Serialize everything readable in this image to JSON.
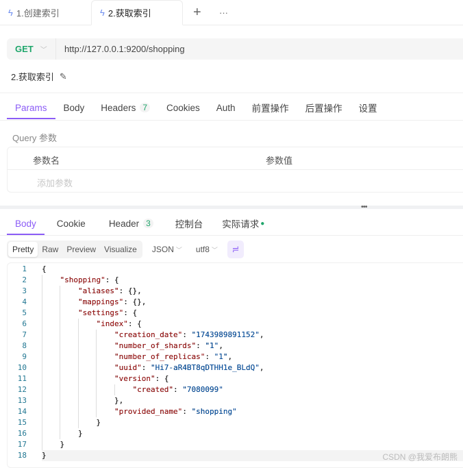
{
  "request_tabs": [
    {
      "label": "1.创建索引",
      "icon": "bolt-icon"
    },
    {
      "label": "2.获取索引",
      "icon": "bolt-icon",
      "active": true
    }
  ],
  "request": {
    "method": "GET",
    "url": "http://127.0.0.1:9200/shopping",
    "name": "2.获取索引"
  },
  "req_tabs": {
    "params": "Params",
    "body": "Body",
    "headers": "Headers",
    "headers_count": "7",
    "cookies": "Cookies",
    "auth": "Auth",
    "pre": "前置操作",
    "post": "后置操作",
    "settings": "设置"
  },
  "query": {
    "label": "Query 参数",
    "col_name": "参数名",
    "col_value": "参数值",
    "add_placeholder": "添加参数"
  },
  "resp_tabs": {
    "body": "Body",
    "cookie": "Cookie",
    "header": "Header",
    "header_count": "3",
    "console": "控制台",
    "actual": "实际请求"
  },
  "toolbar": {
    "pretty": "Pretty",
    "raw": "Raw",
    "preview": "Preview",
    "visualize": "Visualize",
    "format": "JSON",
    "encoding": "utf8"
  },
  "code_lines": [
    "{",
    "    \"shopping\": {",
    "        \"aliases\": {},",
    "        \"mappings\": {},",
    "        \"settings\": {",
    "            \"index\": {",
    "                \"creation_date\": \"1743989891152\",",
    "                \"number_of_shards\": \"1\",",
    "                \"number_of_replicas\": \"1\",",
    "                \"uuid\": \"Hi7-aR4BT8qDTHH1e_BLdQ\",",
    "                \"version\": {",
    "                    \"created\": \"7080099\"",
    "                },",
    "                \"provided_name\": \"shopping\"",
    "            }",
    "        }",
    "    }",
    "}"
  ],
  "watermark": "CSDN @我爱布朗熊",
  "colors": {
    "accent": "#8b5cf6",
    "method": "#1fa66b",
    "key": "#a31515",
    "string": "#0451a5"
  }
}
